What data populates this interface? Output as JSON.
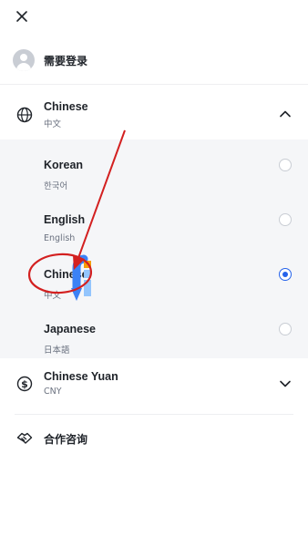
{
  "login": {
    "label": "需要登录"
  },
  "language": {
    "title": "Chinese",
    "subtitle": "中文",
    "expanded": true,
    "options": [
      {
        "name": "Korean",
        "native": "한국어",
        "selected": false
      },
      {
        "name": "English",
        "native": "English",
        "selected": false
      },
      {
        "name": "Chinese",
        "native": "中文",
        "selected": true
      },
      {
        "name": "Japanese",
        "native": "日本語",
        "selected": false
      }
    ]
  },
  "currency": {
    "title": "Chinese Yuan",
    "code": "CNY"
  },
  "cooperation": {
    "label": "合作咨询"
  },
  "colors": {
    "accent": "#2563eb",
    "annotation": "#d32020",
    "highlight": "#3b82f6"
  }
}
